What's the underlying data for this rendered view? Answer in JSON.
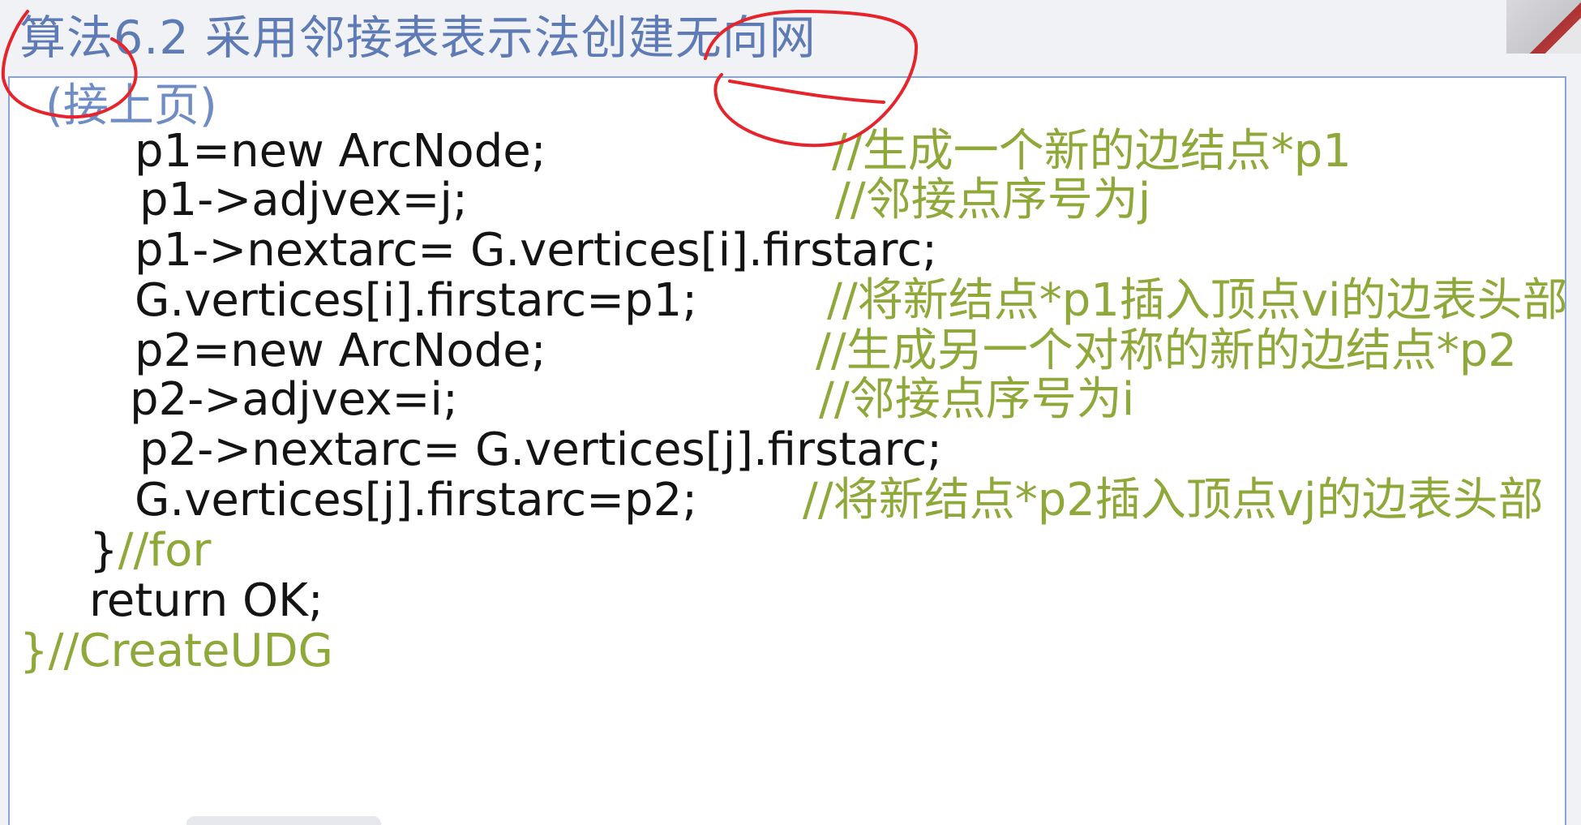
{
  "slide": {
    "title": "算法6.2 采用邻接表表示法创建无向网",
    "continued": "(接上页)",
    "code_lines": [
      {
        "code": "p1=new ArcNode;",
        "comment": "//生成一个新的边结点*p1"
      },
      {
        "code": "p1->adjvex=j;",
        "comment": "//邻接点序号为j"
      },
      {
        "code": "p1->nextarc= G.vertices[i].firstarc;",
        "comment": ""
      },
      {
        "code": "G.vertices[i].firstarc=p1;",
        "comment": "//将新结点*p1插入顶点vi的边表头部"
      },
      {
        "code": "p2=new ArcNode;",
        "comment": "//生成另一个对称的新的边结点*p2"
      },
      {
        "code": "p2->adjvex=i;",
        "comment": "//邻接点序号为i"
      },
      {
        "code": "p2->nextarc= G.vertices[j].firstarc;",
        "comment": ""
      },
      {
        "code": "G.vertices[j].firstarc=p2;",
        "comment": "//将新结点*p2插入顶点vj的边表头部"
      },
      {
        "code": "}",
        "comment": "//for"
      },
      {
        "code": "return OK;",
        "comment": ""
      },
      {
        "code": "}",
        "comment": "//CreateUDG"
      }
    ]
  },
  "colors": {
    "title": "#5f7bb5",
    "code": "#141414",
    "comment": "#8fa83a",
    "annotation": "#e5242b",
    "box_border": "#8aa3cf"
  }
}
